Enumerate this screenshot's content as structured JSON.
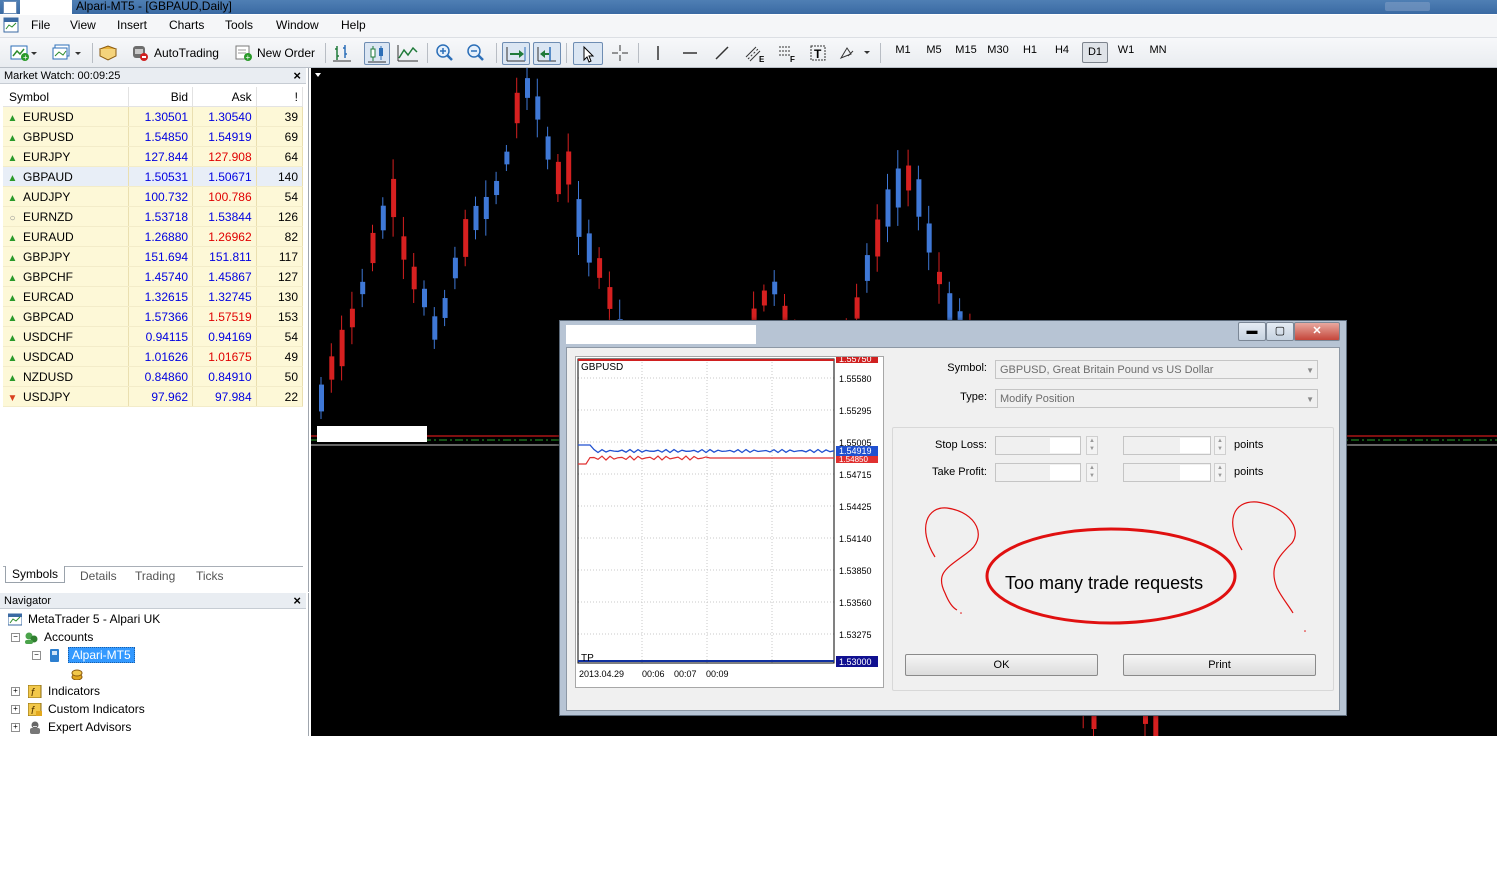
{
  "window": {
    "title": "Alpari-MT5 - [GBPAUD,Daily]"
  },
  "menu": [
    "File",
    "View",
    "Insert",
    "Charts",
    "Tools",
    "Window",
    "Help"
  ],
  "toolbar": {
    "autotrading_label": "AutoTrading",
    "new_order_label": "New Order",
    "timeframes": [
      "M1",
      "M5",
      "M15",
      "M30",
      "H1",
      "H4",
      "D1",
      "W1",
      "MN"
    ],
    "active_timeframe": "D1"
  },
  "market_watch": {
    "title": "Market Watch: 00:09:25",
    "columns": [
      "Symbol",
      "Bid",
      "Ask",
      "!"
    ],
    "rows": [
      {
        "symbol": "EURUSD",
        "bid": "1.30501",
        "ask": "1.30540",
        "spread": "39",
        "trend": "up",
        "ask_color": "blue"
      },
      {
        "symbol": "GBPUSD",
        "bid": "1.54850",
        "ask": "1.54919",
        "spread": "69",
        "trend": "up",
        "ask_color": "blue"
      },
      {
        "symbol": "EURJPY",
        "bid": "127.844",
        "ask": "127.908",
        "spread": "64",
        "trend": "up",
        "ask_color": "red"
      },
      {
        "symbol": "GBPAUD",
        "bid": "1.50531",
        "ask": "1.50671",
        "spread": "140",
        "trend": "up",
        "ask_color": "blue"
      },
      {
        "symbol": "AUDJPY",
        "bid": "100.732",
        "ask": "100.786",
        "spread": "54",
        "trend": "up",
        "ask_color": "red"
      },
      {
        "symbol": "EURNZD",
        "bid": "1.53718",
        "ask": "1.53844",
        "spread": "126",
        "trend": "neutral",
        "ask_color": "blue"
      },
      {
        "symbol": "EURAUD",
        "bid": "1.26880",
        "ask": "1.26962",
        "spread": "82",
        "trend": "up",
        "ask_color": "red"
      },
      {
        "symbol": "GBPJPY",
        "bid": "151.694",
        "ask": "151.811",
        "spread": "117",
        "trend": "up",
        "ask_color": "blue"
      },
      {
        "symbol": "GBPCHF",
        "bid": "1.45740",
        "ask": "1.45867",
        "spread": "127",
        "trend": "up",
        "ask_color": "blue"
      },
      {
        "symbol": "EURCAD",
        "bid": "1.32615",
        "ask": "1.32745",
        "spread": "130",
        "trend": "up",
        "ask_color": "blue"
      },
      {
        "symbol": "GBPCAD",
        "bid": "1.57366",
        "ask": "1.57519",
        "spread": "153",
        "trend": "up",
        "ask_color": "red"
      },
      {
        "symbol": "USDCHF",
        "bid": "0.94115",
        "ask": "0.94169",
        "spread": "54",
        "trend": "up",
        "ask_color": "blue"
      },
      {
        "symbol": "USDCAD",
        "bid": "1.01626",
        "ask": "1.01675",
        "spread": "49",
        "trend": "up",
        "ask_color": "red"
      },
      {
        "symbol": "NZDUSD",
        "bid": "0.84860",
        "ask": "0.84910",
        "spread": "50",
        "trend": "up",
        "ask_color": "blue"
      },
      {
        "symbol": "USDJPY",
        "bid": "97.962",
        "ask": "97.984",
        "spread": "22",
        "trend": "down",
        "ask_color": "blue"
      }
    ],
    "selected_row": 3,
    "tabs": [
      "Symbols",
      "Details",
      "Trading",
      "Ticks"
    ],
    "active_tab": "Symbols"
  },
  "navigator": {
    "title": "Navigator",
    "root": "MetaTrader 5 - Alpari UK",
    "accounts": "Accounts",
    "account": "Alpari-MT5",
    "indicators": "Indicators",
    "custom_indicators": "Custom Indicators",
    "expert_advisors": "Expert Advisors"
  },
  "dialog": {
    "symbol_label": "Symbol:",
    "symbol_value": "GBPUSD, Great Britain Pound vs US Dollar",
    "type_label": "Type:",
    "type_value": "Modify Position",
    "stop_loss_label": "Stop Loss:",
    "take_profit_label": "Take Profit:",
    "points_label": "points",
    "message": "Too many trade requests",
    "ok_label": "OK",
    "print_label": "Print",
    "win_buttons": [
      "▬",
      "▢",
      "✕"
    ],
    "mini_chart": {
      "symbol": "GBPUSD",
      "tp_label": "TP",
      "price_levels": [
        "1.55580",
        "1.55295",
        "1.55005",
        "1.54715",
        "1.54425",
        "1.54140",
        "1.53850",
        "1.53560",
        "1.53275"
      ],
      "top_marker": "1.55750",
      "ask_marker": "1.54919",
      "bid_marker": "1.54850",
      "bottom_marker": "1.53000",
      "time_labels": [
        "2013.04.29",
        "00:06",
        "00:07",
        "00:09"
      ]
    }
  },
  "colors": {
    "bull_candle": "#3f78d6",
    "bear_candle": "#d62020",
    "chart_bg": "#000000",
    "row_bg": "#fdf8d7"
  }
}
